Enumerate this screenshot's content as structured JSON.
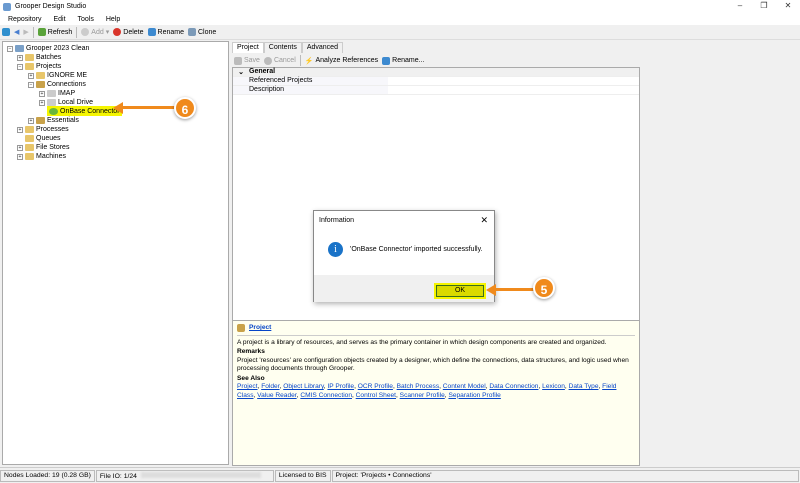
{
  "window": {
    "title": "Grooper Design Studio"
  },
  "menu": [
    "Repository",
    "Edit",
    "Tools",
    "Help"
  ],
  "toolbar": {
    "refresh": "Refresh",
    "add": "Add",
    "delete": "Delete",
    "rename": "Rename",
    "clone": "Clone"
  },
  "tree": {
    "root": "Grooper 2023 Clean",
    "batches": "Batches",
    "projects": "Projects",
    "ignore": "IGNORE ME",
    "connections": "Connections",
    "imap": "IMAP",
    "local": "Local Drive",
    "onbase": "OnBase Connector",
    "essentials": "Essentials",
    "processes": "Processes",
    "queues": "Queues",
    "filestores": "File Stores",
    "machines": "Machines"
  },
  "tabs": [
    "Project",
    "Contents",
    "Advanced"
  ],
  "rtool": {
    "save": "Save",
    "cancel": "Cancel",
    "analyze": "Analyze References",
    "rename": "Rename..."
  },
  "grid": {
    "category": "General",
    "rows": [
      "Referenced Projects",
      "Description"
    ]
  },
  "help": {
    "title": "Project",
    "desc": "A project is a library of resources, and serves as the primary container in which design components are created and organized.",
    "remarks_h": "Remarks",
    "remarks": "Project 'resources' are configuration objects created by a designer, which define the connections, data structures, and logic used when processing documents through Grooper.",
    "seealso_h": "See Also",
    "links": [
      "Project",
      "Folder",
      "Object Library",
      "IP Profile",
      "OCR Profile",
      "Batch Process",
      "Content Model",
      "Data Connection",
      "Lexicon",
      "Data Type",
      "Field Class",
      "Value Reader",
      "CMIS Connection",
      "Control Sheet",
      "Scanner Profile",
      "Separation Profile"
    ]
  },
  "dialog": {
    "title": "Information",
    "message": "'OnBase Connector' imported successfully.",
    "ok": "OK"
  },
  "callouts": {
    "a": "6",
    "b": "5"
  },
  "status": {
    "nodes": "Nodes Loaded: 19 (0.28 GB)",
    "fileio": "File IO: 1/24",
    "license": "Licensed to BIS",
    "project": "Project: 'Projects • Connections'"
  }
}
